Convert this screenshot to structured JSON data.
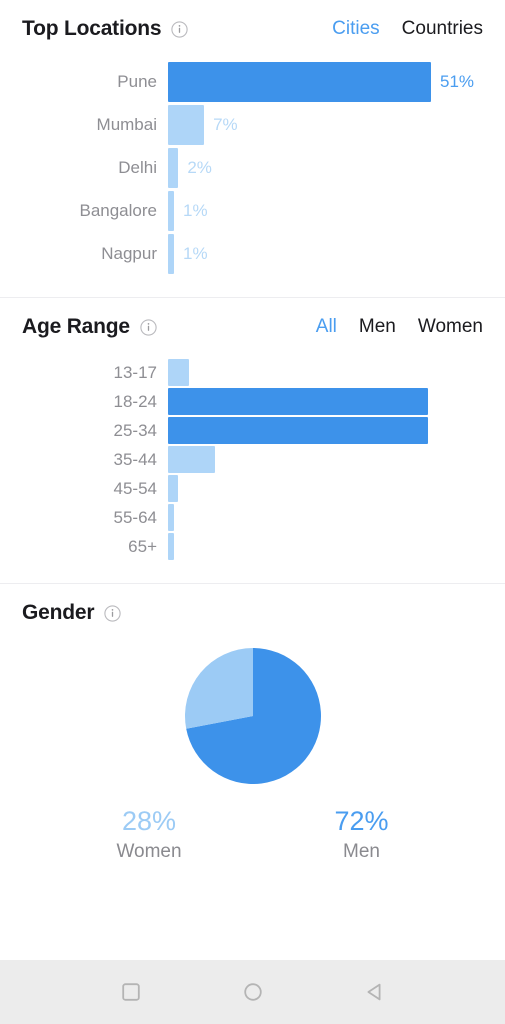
{
  "colors": {
    "accent": "#4a9df0",
    "bar_strong": "#3d92ea",
    "bar_light": "#aed5f8",
    "value_light": "#b7d9f7",
    "label_gray": "#8e8e93",
    "title_dark": "#1b1b1f",
    "navbar_bg": "#ececec",
    "divider": "#ededf0"
  },
  "top_locations": {
    "title": "Top Locations",
    "info_icon": "info-circle-icon",
    "tabs": [
      {
        "label": "Cities",
        "active": true
      },
      {
        "label": "Countries",
        "active": false
      }
    ],
    "chart_data": {
      "type": "bar",
      "orientation": "horizontal",
      "title": "Top Locations",
      "xlabel": "",
      "ylabel": "",
      "categories": [
        "Pune",
        "Mumbai",
        "Delhi",
        "Bangalore",
        "Nagpur"
      ],
      "values": [
        51,
        7,
        2,
        1,
        1
      ],
      "value_labels": [
        "51%",
        "7%",
        "2%",
        "1%",
        "1%"
      ],
      "highlight_index": 0,
      "xlim": [
        0,
        51
      ],
      "grid": false,
      "legend": "none"
    }
  },
  "age_range": {
    "title": "Age Range",
    "info_icon": "info-circle-icon",
    "tabs": [
      {
        "label": "All",
        "active": true
      },
      {
        "label": "Men",
        "active": false
      },
      {
        "label": "Women",
        "active": false
      }
    ],
    "chart_data": {
      "type": "bar",
      "orientation": "horizontal",
      "title": "Age Range",
      "xlabel": "",
      "ylabel": "",
      "categories": [
        "13-17",
        "18-24",
        "25-34",
        "35-44",
        "45-54",
        "55-64",
        "65+"
      ],
      "values": [
        8,
        100,
        100,
        18,
        4,
        2,
        2
      ],
      "highlight_indices": [
        1,
        2
      ],
      "xlim": [
        0,
        100
      ],
      "grid": false,
      "legend": "none"
    }
  },
  "gender": {
    "title": "Gender",
    "info_icon": "info-circle-icon",
    "chart_data": {
      "type": "pie",
      "title": "Gender",
      "labels": [
        "Men",
        "Women"
      ],
      "values": [
        72,
        28
      ],
      "colors": [
        "#3d92ea",
        "#9ccbf5"
      ],
      "start_angle_deg": 0,
      "legend": "below"
    },
    "legend": [
      {
        "pct": "28%",
        "name": "Women",
        "strong": false
      },
      {
        "pct": "72%",
        "name": "Men",
        "strong": true
      }
    ]
  },
  "navbar": {
    "buttons": [
      {
        "icon": "recents-square-icon",
        "name": "recents"
      },
      {
        "icon": "home-circle-icon",
        "name": "home"
      },
      {
        "icon": "back-triangle-icon",
        "name": "back"
      }
    ]
  }
}
